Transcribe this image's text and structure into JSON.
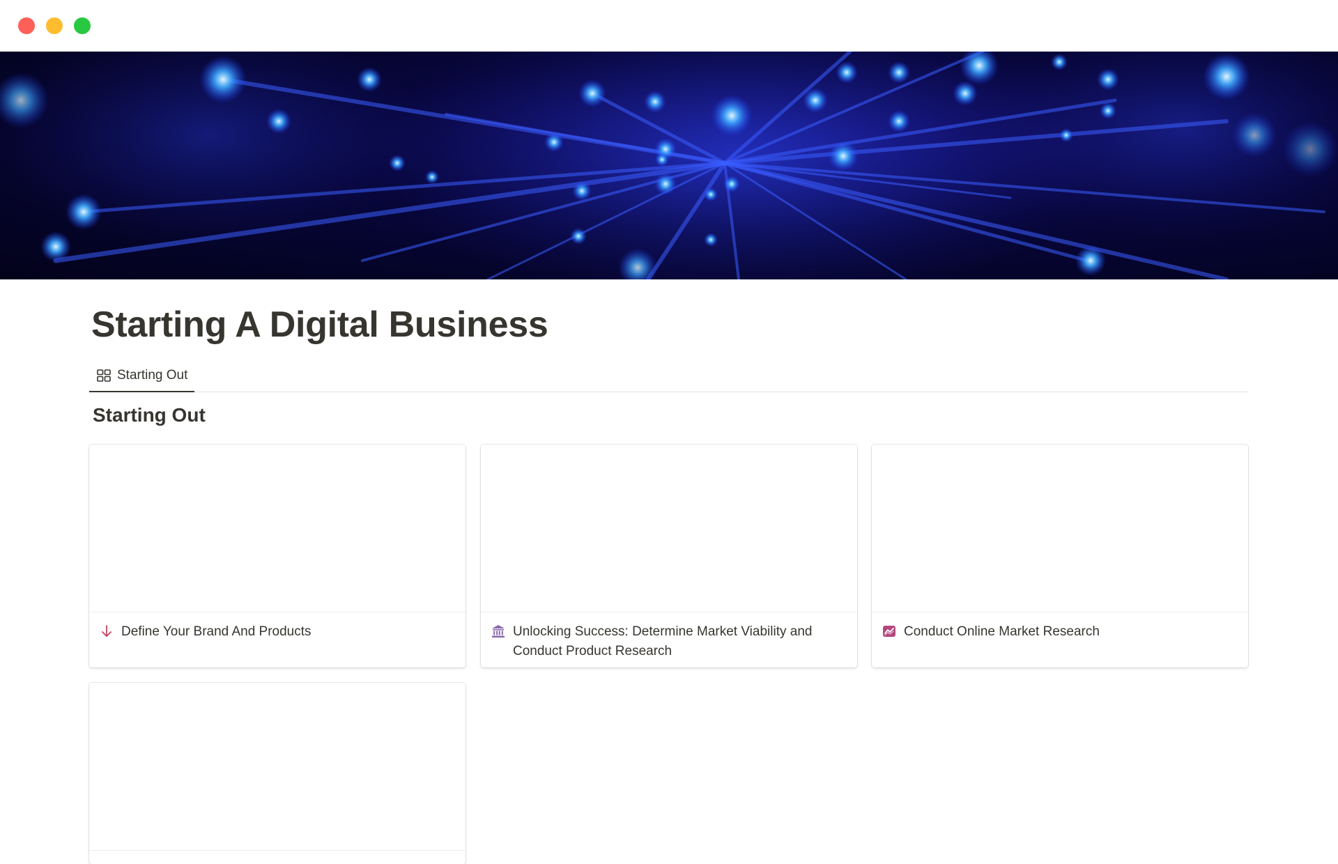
{
  "window": {
    "controls": [
      "close",
      "minimize",
      "zoom"
    ]
  },
  "cover": {
    "description_icon": "fiber-optic-cover-image"
  },
  "page": {
    "title": "Starting A Digital Business"
  },
  "views": {
    "tabs": [
      {
        "label": "Starting Out",
        "icon": "gallery-view-icon",
        "active": true
      }
    ]
  },
  "section": {
    "heading": "Starting Out"
  },
  "cards": [
    {
      "title": "Define Your Brand And Products",
      "icon": "arrow-down-icon",
      "icon_color": "#c4445f"
    },
    {
      "title": "Unlocking Success: Determine Market Viability and Conduct Product Research",
      "icon": "bank-icon",
      "icon_color": "#8a67ab"
    },
    {
      "title": "Conduct Online Market Research",
      "icon": "chart-icon",
      "icon_color": "#b3477d"
    },
    {
      "title": "",
      "icon": "",
      "icon_color": ""
    }
  ]
}
